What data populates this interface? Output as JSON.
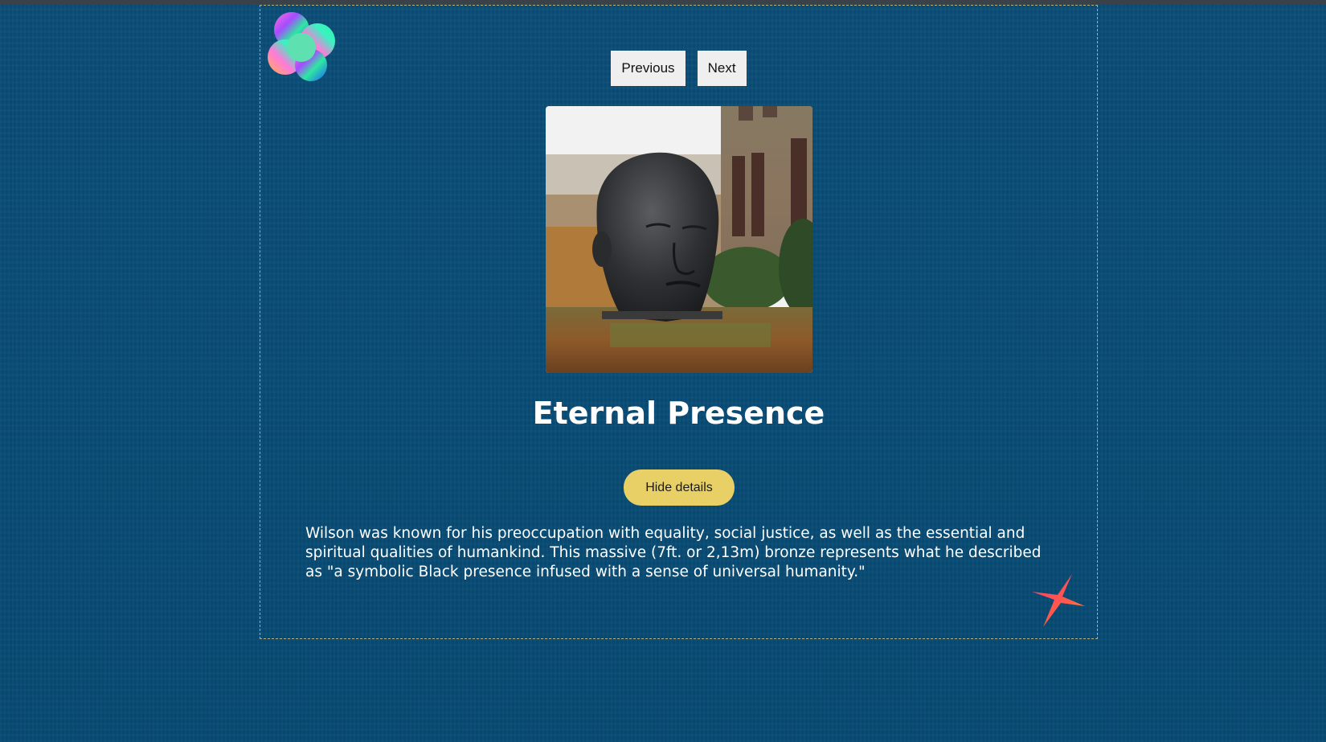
{
  "nav": {
    "previous_label": "Previous",
    "next_label": "Next"
  },
  "artwork": {
    "title": "Eternal Presence",
    "image_alt": "Eternal Presence",
    "toggle_label": "Hide details",
    "description": "Wilson was known for his preoccupation with equality, social justice, as well as the essential and spiritual qualities of humankind. This massive (7ft. or 2,13m) bronze represents what he described as \"a symbolic Black presence infused with a sense of universal humanity.\""
  },
  "icons": {
    "logo": "rainbow-clover-logo-icon",
    "corner": "four-point-star-icon"
  },
  "colors": {
    "page_background": "#074f7a",
    "toggle_button": "#e8d067",
    "frame_border": "#b8b07a"
  }
}
